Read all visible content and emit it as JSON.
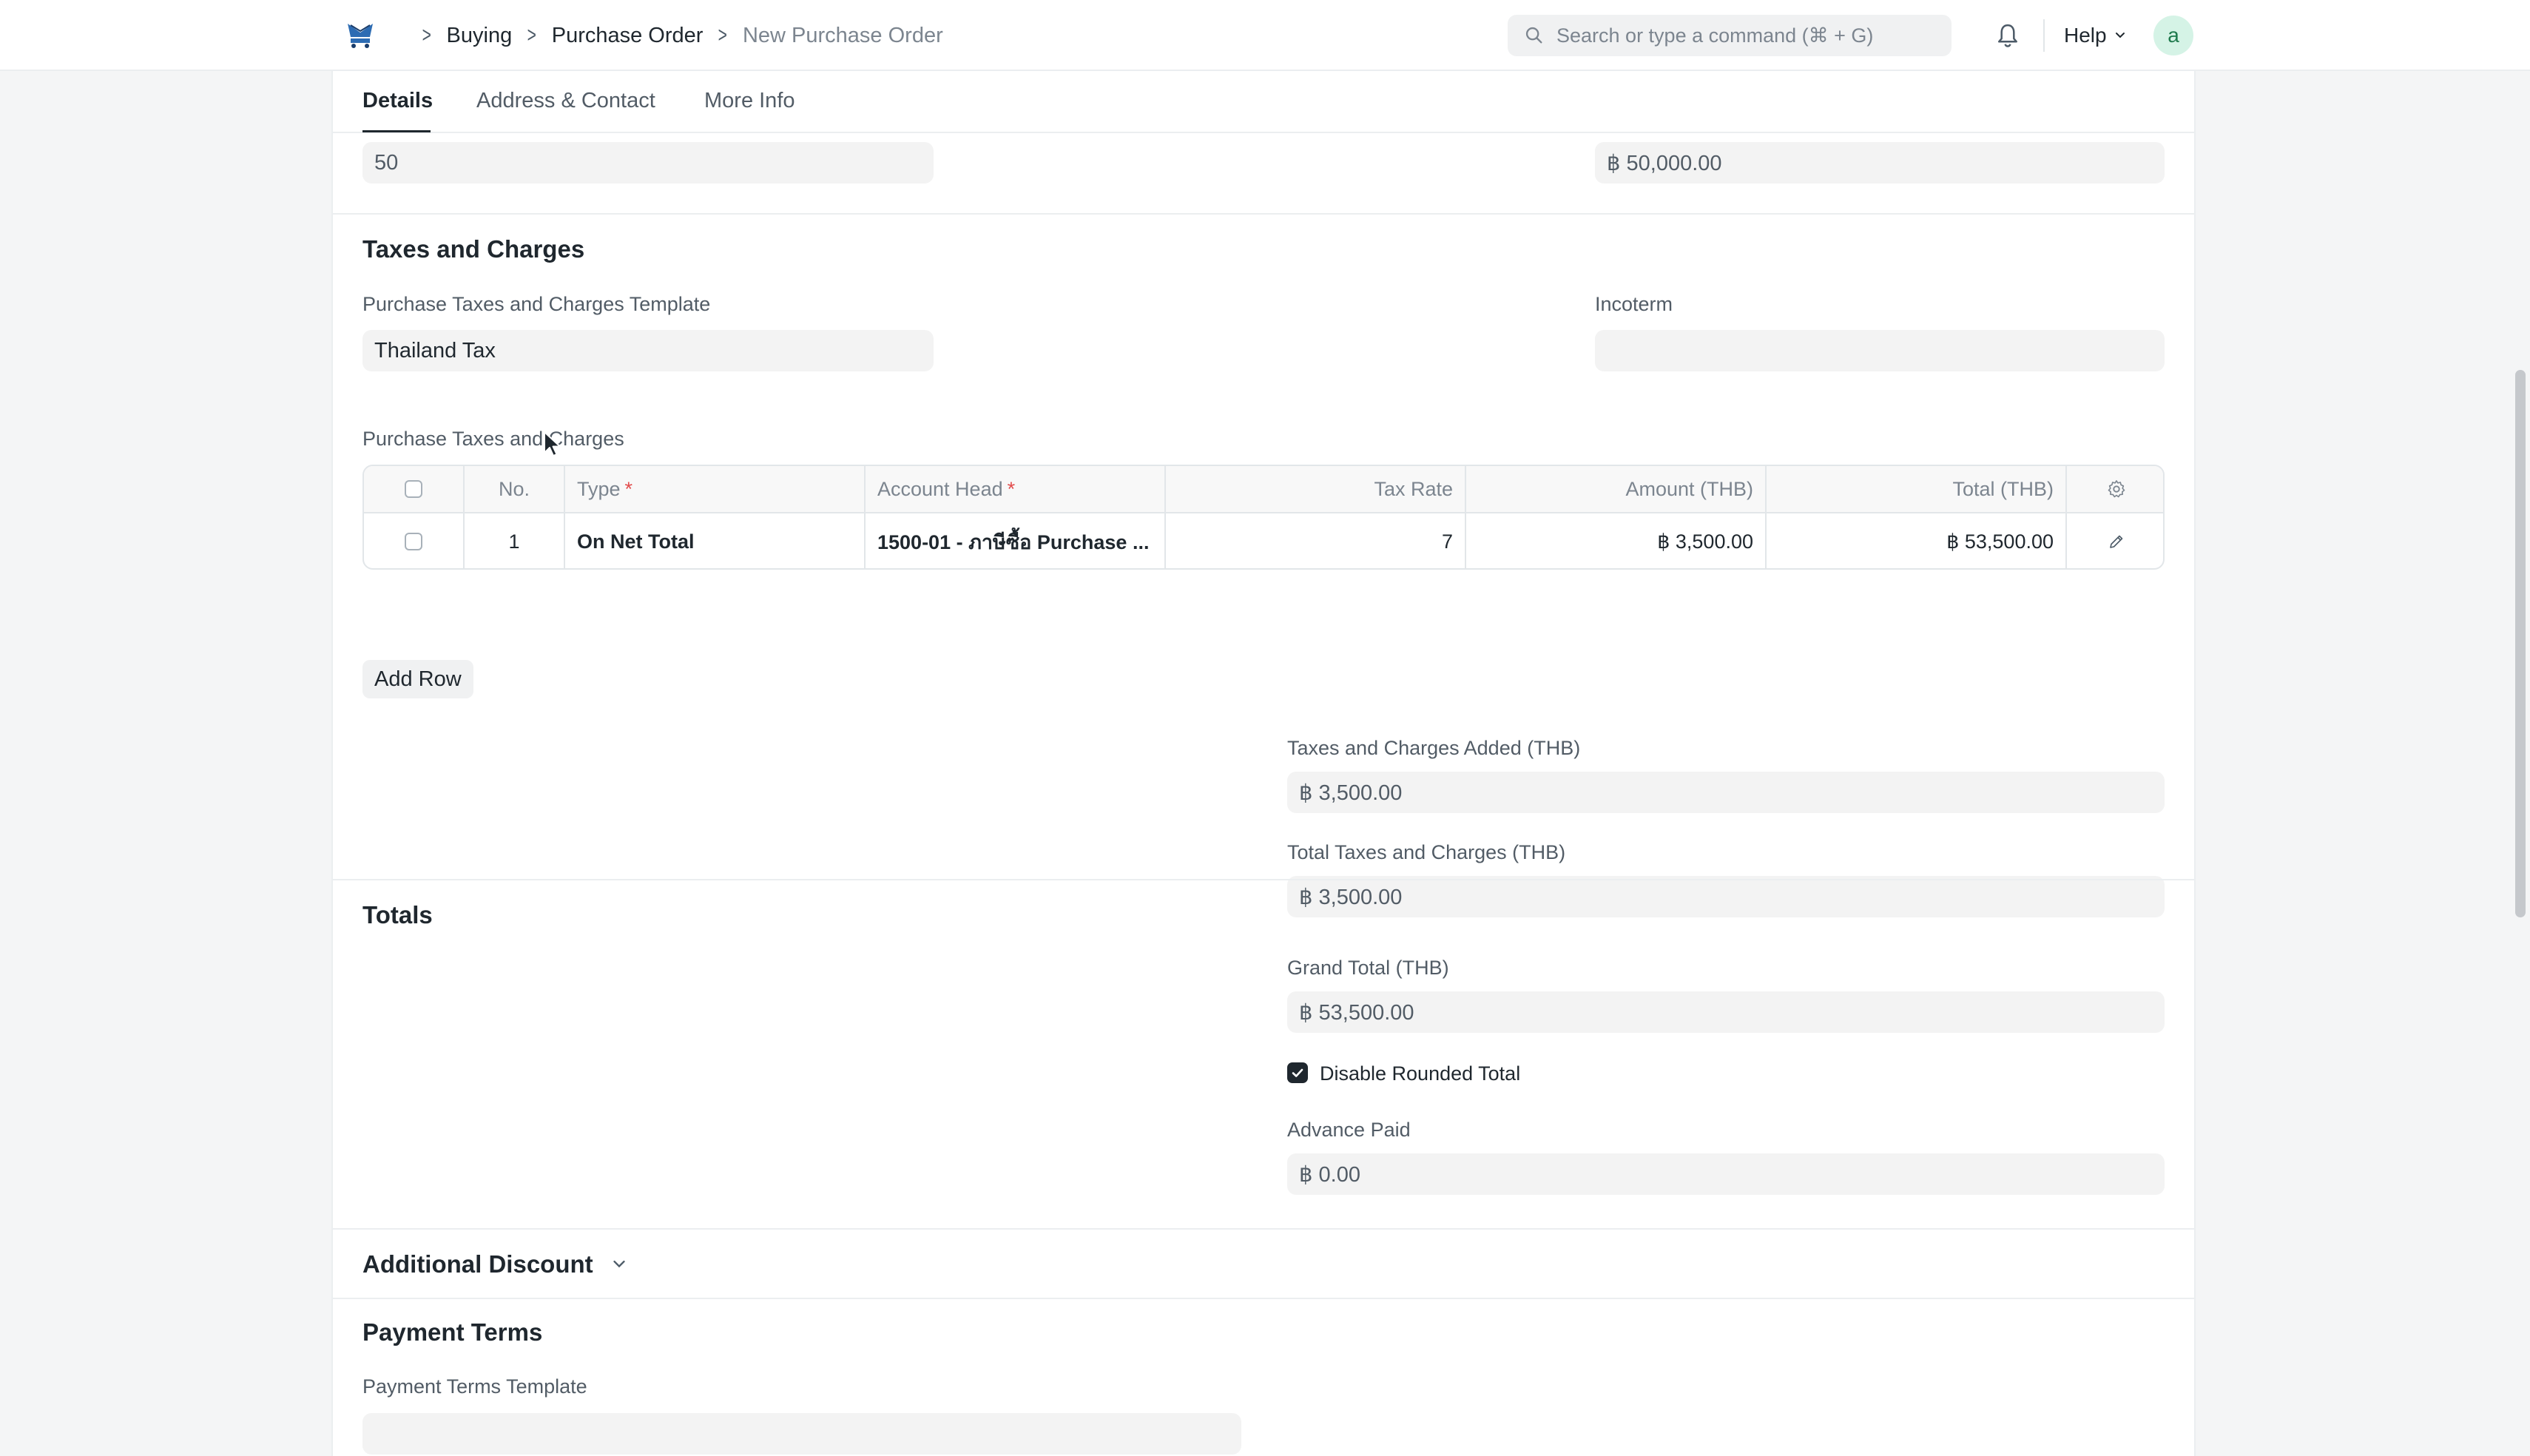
{
  "navbar": {
    "breadcrumbs": [
      "Buying",
      "Purchase Order",
      "New Purchase Order"
    ],
    "search_placeholder": "Search or type a command (⌘ + G)",
    "help_label": "Help",
    "avatar_letter": "a"
  },
  "tabs": [
    "Details",
    "Address & Contact",
    "More Info"
  ],
  "top_fields": {
    "left_value": "50",
    "right_value": "฿ 50,000.00"
  },
  "taxes_section": {
    "title": "Taxes and Charges",
    "template_label": "Purchase Taxes and Charges Template",
    "template_value": "Thailand Tax",
    "incoterm_label": "Incoterm",
    "incoterm_value": "",
    "table_label": "Purchase Taxes and Charges",
    "table": {
      "columns": [
        "No.",
        "Type",
        "Account Head",
        "Tax Rate",
        "Amount (THB)",
        "Total (THB)"
      ],
      "rows": [
        {
          "no": "1",
          "type": "On Net Total",
          "account_head": "1500-01 - ภาษีซื้อ Purchase ...",
          "tax_rate": "7",
          "amount": "฿ 3,500.00",
          "total": "฿ 53,500.00"
        }
      ]
    },
    "add_row_label": "Add Row",
    "added_label": "Taxes and Charges Added (THB)",
    "added_value": "฿ 3,500.00",
    "total_label": "Total Taxes and Charges (THB)",
    "total_value": "฿ 3,500.00"
  },
  "totals_section": {
    "title": "Totals",
    "grand_total_label": "Grand Total (THB)",
    "grand_total_value": "฿ 53,500.00",
    "disable_rounded_label": "Disable Rounded Total",
    "disable_rounded_checked": true,
    "advance_paid_label": "Advance Paid",
    "advance_paid_value": "฿ 0.00"
  },
  "additional_discount": {
    "title": "Additional Discount"
  },
  "payment_terms": {
    "title": "Payment Terms",
    "template_label": "Payment Terms Template",
    "template_value": ""
  },
  "colors": {
    "page_bg": "#f4f5f6",
    "card_bg": "#ffffff",
    "input_bg": "#f3f3f3",
    "text": "#1f272e",
    "muted": "#7c858f",
    "required": "#e24c4c",
    "avatar_bg": "#d5f3e6"
  }
}
